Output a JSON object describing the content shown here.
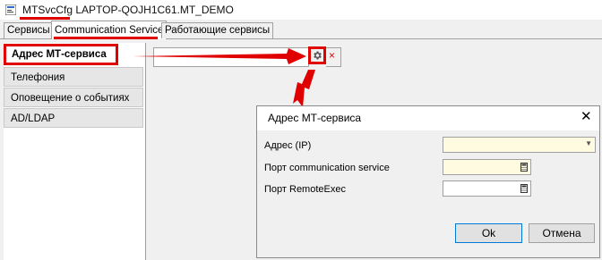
{
  "window": {
    "title_app": "MTSvcCfg",
    "title_rest": " LAPTOP-QOJH1C61.MT_DEMO"
  },
  "tabs": [
    {
      "label": "Сервисы"
    },
    {
      "label": "Communication Service"
    },
    {
      "label": "Работающие сервисы"
    }
  ],
  "nav": [
    {
      "label": "Адрес МТ-сервиса"
    },
    {
      "label": "Телефония"
    },
    {
      "label": "Оповещение о событиях"
    },
    {
      "label": "AD/LDAP"
    }
  ],
  "address_field": {
    "value": ""
  },
  "clear_symbol": "×",
  "dialog": {
    "title": "Адрес МТ-сервиса",
    "close_symbol": "✕",
    "fields": [
      {
        "label": "Адрес (IP)",
        "value": ""
      },
      {
        "label": "Порт communication service",
        "value": ""
      },
      {
        "label": "Порт RemoteExec",
        "value": ""
      }
    ],
    "ok_label": "Ok",
    "cancel_label": "Отмена"
  },
  "colors": {
    "annotation": "#e00000",
    "required_field": "#fffbe0",
    "accent": "#0078d7"
  },
  "icons": [
    "app-icon",
    "gear-icon",
    "clear-icon",
    "close-icon",
    "dropdown-arrow-icon",
    "calculator-icon"
  ]
}
